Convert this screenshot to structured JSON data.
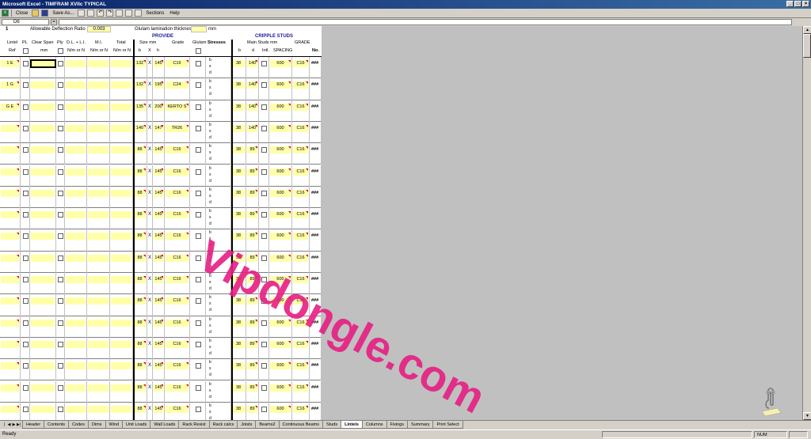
{
  "window": {
    "title": "Microsoft Excel - TIMFRAM XVIIc TYPICAL",
    "minimize": "_",
    "maximize": "□",
    "close": "×"
  },
  "toolbar": {
    "close_label": "Close",
    "save_as_label": "Save As...",
    "sections_label": "Sections",
    "help_label": "Help"
  },
  "formula_bar": {
    "name_box": "D6",
    "fx": "="
  },
  "sheet": {
    "row_number": "1",
    "deflection_label": "Allowable Deflection Ratio",
    "deflection_value": "0.003",
    "glulam_thickness_label": "Glulam lamination thickness",
    "glulam_thickness_unit": "mm",
    "provide_header": "PROVIDE",
    "cripple_header": "CRIPPLE STUDS",
    "col_headers": {
      "lintel": "Lintel",
      "ref": "Ref",
      "pl": "PL",
      "clear_span": "Clear Span",
      "mm": "mm",
      "ply": "Ply",
      "dl_li": "D.L. + L.I.",
      "nm_or_n": "N/m or N",
      "mi": "M.I.",
      "total": "Total",
      "size_mm": "Size mm",
      "b": "b",
      "x": "X",
      "h": "h",
      "grade": "Grade",
      "glulam": "Glulam",
      "stresses": "Stresses",
      "main_studs_mm": "Main Studs mm",
      "sb": "b",
      "sd": "d",
      "intl": "Intl.",
      "spacing": "SPACING",
      "grade2": "GRADE",
      "no": "No."
    },
    "stress_letters": [
      "b",
      "s",
      "d"
    ],
    "rows": [
      {
        "ref": "1 E",
        "b": "132",
        "h": "145",
        "grade": "C16",
        "sb": "38",
        "sd": "140",
        "spacing": "600",
        "grade2": "C16",
        "no": "###"
      },
      {
        "ref": "1 G",
        "b": "132",
        "h": "195",
        "grade": "C24",
        "sb": "38",
        "sd": "140",
        "spacing": "600",
        "grade2": "C16",
        "no": "###"
      },
      {
        "ref": "G E",
        "b": "135",
        "h": "200",
        "grade": "KERTO S",
        "sb": "38",
        "sd": "140",
        "spacing": "600",
        "grade2": "C16",
        "no": "###"
      },
      {
        "ref": "",
        "b": "140",
        "h": "147",
        "grade": "TR26",
        "sb": "38",
        "sd": "140",
        "spacing": "600",
        "grade2": "C16",
        "no": "###"
      },
      {
        "ref": "",
        "b": "88",
        "h": "145",
        "grade": "C16",
        "sb": "38",
        "sd": "89",
        "spacing": "600",
        "grade2": "C16",
        "no": "###"
      },
      {
        "ref": "",
        "b": "88",
        "h": "145",
        "grade": "C16",
        "sb": "38",
        "sd": "89",
        "spacing": "600",
        "grade2": "C16",
        "no": "###"
      },
      {
        "ref": "",
        "b": "88",
        "h": "145",
        "grade": "C16",
        "sb": "38",
        "sd": "89",
        "spacing": "600",
        "grade2": "C16",
        "no": "###"
      },
      {
        "ref": "",
        "b": "88",
        "h": "145",
        "grade": "C16",
        "sb": "38",
        "sd": "89",
        "spacing": "600",
        "grade2": "C16",
        "no": "###"
      },
      {
        "ref": "",
        "b": "88",
        "h": "145",
        "grade": "C16",
        "sb": "38",
        "sd": "89",
        "spacing": "600",
        "grade2": "C16",
        "no": "###"
      },
      {
        "ref": "",
        "b": "88",
        "h": "145",
        "grade": "C16",
        "sb": "38",
        "sd": "89",
        "spacing": "600",
        "grade2": "C16",
        "no": "###"
      },
      {
        "ref": "",
        "b": "88",
        "h": "145",
        "grade": "C16",
        "sb": "38",
        "sd": "89",
        "spacing": "600",
        "grade2": "C16",
        "no": "###"
      },
      {
        "ref": "",
        "b": "88",
        "h": "145",
        "grade": "C16",
        "sb": "38",
        "sd": "89",
        "spacing": "600",
        "grade2": "C16",
        "no": "###"
      },
      {
        "ref": "",
        "b": "88",
        "h": "145",
        "grade": "C16",
        "sb": "38",
        "sd": "89",
        "spacing": "600",
        "grade2": "C16",
        "no": "###"
      },
      {
        "ref": "",
        "b": "88",
        "h": "145",
        "grade": "C16",
        "sb": "38",
        "sd": "89",
        "spacing": "600",
        "grade2": "C16",
        "no": "###"
      },
      {
        "ref": "",
        "b": "88",
        "h": "145",
        "grade": "C16",
        "sb": "38",
        "sd": "89",
        "spacing": "600",
        "grade2": "C16",
        "no": "###"
      },
      {
        "ref": "",
        "b": "88",
        "h": "145",
        "grade": "C16",
        "sb": "38",
        "sd": "89",
        "spacing": "600",
        "grade2": "C16",
        "no": "###"
      },
      {
        "ref": "",
        "b": "88",
        "h": "145",
        "grade": "C16",
        "sb": "38",
        "sd": "89",
        "spacing": "600",
        "grade2": "C16",
        "no": "###"
      }
    ]
  },
  "watermark": "Vipdongle.com",
  "tabs": [
    "Header",
    "Contents",
    "Codes",
    "Dims",
    "Wind",
    "Unit Loads",
    "Wall Loads",
    "Rack Resist",
    "Rack calcs",
    "Joists",
    "Beams2",
    "Continuous Beams",
    "Studs",
    "Lintels",
    "Columns",
    "Fixings",
    "Summary",
    "Print Select"
  ],
  "active_tab": "Lintels",
  "status": {
    "left": "Ready",
    "num": "NUM"
  },
  "colors": {
    "title_bar": "#0a246a",
    "cell_yellow": "#ffffa8",
    "header_blue": "#1a1aa0",
    "watermark": "#e61e82"
  }
}
